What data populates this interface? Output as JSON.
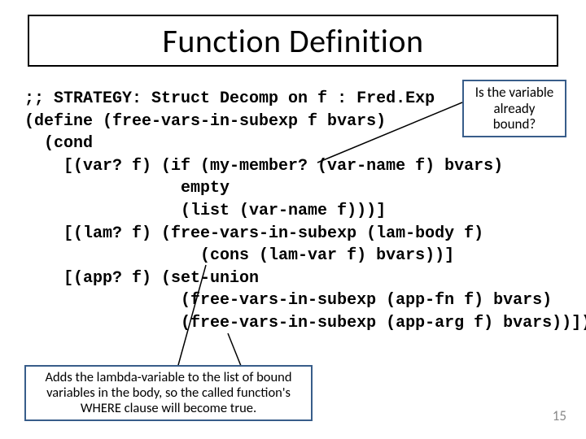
{
  "title": "Function Definition",
  "callouts": {
    "top_right": "Is the variable already bound?",
    "bottom_left": "Adds the lambda-variable to the list of bound variables in the body, so the called function's WHERE clause will become true."
  },
  "code": ";; STRATEGY: Struct Decomp on f : Fred.Exp\n(define (free-vars-in-subexp f bvars)\n  (cond\n    [(var? f) (if (my-member? (var-name f) bvars)\n                empty\n                (list (var-name f)))]\n    [(lam? f) (free-vars-in-subexp (lam-body f)\n                  (cons (lam-var f) bvars))]\n    [(app? f) (set-union\n                (free-vars-in-subexp (app-fn f) bvars)\n                (free-vars-in-subexp (app-arg f) bvars))]))",
  "page_number": "15"
}
